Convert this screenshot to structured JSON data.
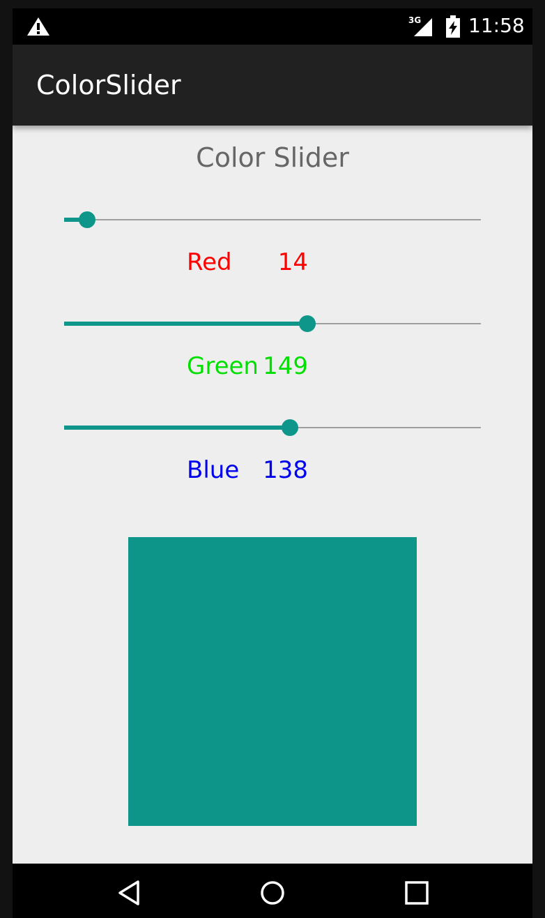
{
  "status_bar": {
    "network": "3G",
    "time": "11:58",
    "icons": [
      "warning-icon",
      "signal-icon",
      "battery-charging-icon"
    ]
  },
  "app_bar": {
    "title": "ColorSlider"
  },
  "main": {
    "title": "Color Slider",
    "sliders": [
      {
        "name": "Red",
        "value": "14",
        "max": 255,
        "label_color": "#ff0000"
      },
      {
        "name": "Green",
        "value": "149",
        "max": 255,
        "label_color": "#00e000"
      },
      {
        "name": "Blue",
        "value": "138",
        "max": 255,
        "label_color": "#0000ee"
      }
    ],
    "preview_color": "#0e958a"
  },
  "colors": {
    "accent": "#0f968a",
    "track": "#9e9e9e",
    "background": "#eeeeee",
    "app_bar": "#212121"
  },
  "nav_bar": {
    "buttons": [
      "back-icon",
      "home-icon",
      "recents-icon"
    ]
  }
}
